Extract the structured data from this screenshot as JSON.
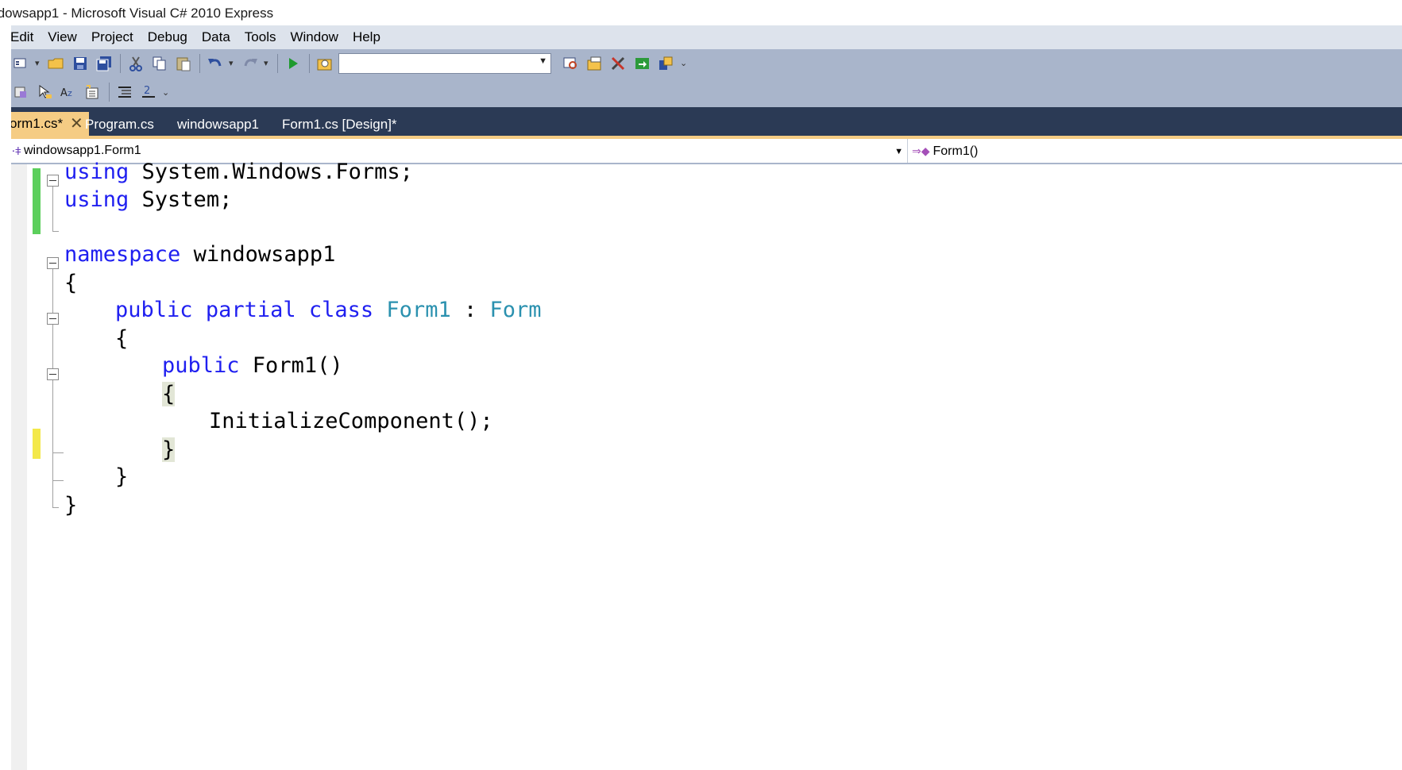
{
  "window": {
    "title": "ıdowsapp1 - Microsoft Visual C# 2010 Express"
  },
  "menu": {
    "items": [
      "Edit",
      "View",
      "Project",
      "Debug",
      "Data",
      "Tools",
      "Window",
      "Help"
    ]
  },
  "toolbar1": {
    "buttons": [
      "new-project-icon",
      "open-file-icon",
      "save-icon",
      "save-all-icon",
      "cut-icon",
      "copy-icon",
      "paste-icon",
      "undo-icon",
      "redo-icon",
      "start-debugging-icon",
      "find-in-files-icon",
      "solution-explorer-icon",
      "properties-icon",
      "toolbox-icon",
      "start-page-icon",
      "extension-manager-icon"
    ],
    "config_value": ""
  },
  "toolbar2": {
    "buttons": [
      "display-member-list-icon",
      "parameter-info-icon",
      "quick-info-icon",
      "word-completion-icon",
      "comment-lines-icon",
      "uncomment-lines-icon"
    ]
  },
  "tabs": {
    "active": "orm1.cs*",
    "items": [
      "Program.cs",
      "windowsapp1",
      "Form1.cs [Design]*"
    ]
  },
  "nav": {
    "type_value": "windowsapp1.Form1",
    "member_value": "Form1()"
  },
  "code": {
    "lines": [
      {
        "k1": "using",
        "t1": " System.Windows.Forms;"
      },
      {
        "k1": "using",
        "t1": " System;"
      },
      {
        "k1": "namespace",
        "t1": " windowsapp1"
      },
      {
        "t1": "{"
      },
      {
        "k1": "public",
        "k2": "partial",
        "k3": "class",
        "ty1": "Form1",
        "t1": " : ",
        "ty2": "Form"
      },
      {
        "t1": "{"
      },
      {
        "k1": "public",
        "t1": " Form1()"
      },
      {
        "t1": "{"
      },
      {
        "t1": "InitializeComponent();"
      },
      {
        "t1": "}"
      },
      {
        "t1": "}"
      },
      {
        "t1": "}"
      }
    ]
  },
  "colors": {
    "keyword": "#1f1ff0",
    "type": "#2b91af",
    "tab_active": "#f5cc84",
    "tabstrip": "#2b3a55",
    "toolbar": "#a9b5cb",
    "menubar": "#dde3ec",
    "change_saved": "#5ccf5c",
    "change_unsaved": "#f3e84a"
  }
}
